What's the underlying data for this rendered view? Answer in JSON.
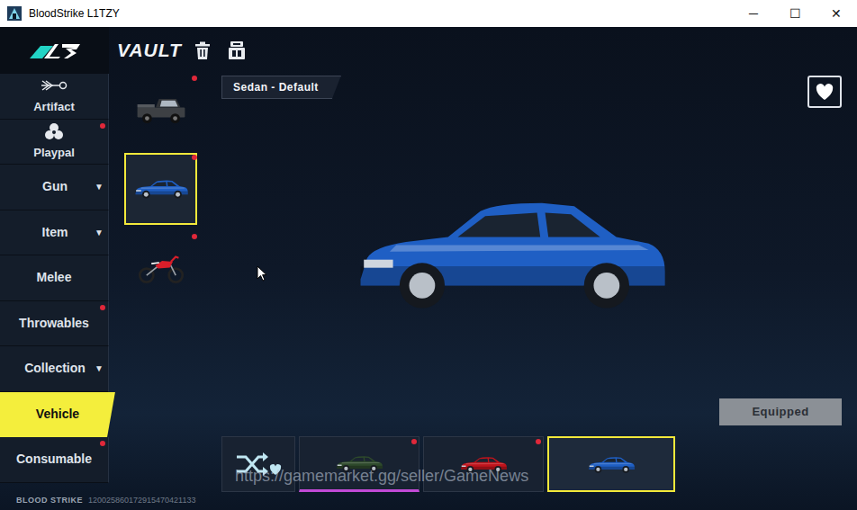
{
  "window": {
    "title": "BloodStrike L1TZY",
    "controls": [
      "─",
      "☐",
      "✕"
    ]
  },
  "header": {
    "title": "VAULT"
  },
  "sidebar": {
    "items": [
      {
        "label": "Artifact",
        "kind": "artifact",
        "selected": false,
        "new": false
      },
      {
        "label": "Playpal",
        "kind": "playpal",
        "selected": false,
        "new": true
      },
      {
        "label": "Gun",
        "kind": "text",
        "arrow": "▼",
        "selected": false,
        "new": false
      },
      {
        "label": "Item",
        "kind": "text",
        "arrow": "▼",
        "selected": false,
        "new": false
      },
      {
        "label": "Melee",
        "kind": "text",
        "selected": false,
        "new": false
      },
      {
        "label": "Throwables",
        "kind": "text",
        "selected": false,
        "new": true
      },
      {
        "label": "Collection",
        "kind": "text",
        "arrow": "▼",
        "selected": false,
        "new": false
      },
      {
        "label": "Vehicle",
        "kind": "text",
        "selected": true,
        "new": false
      },
      {
        "label": "Consumable",
        "kind": "text",
        "selected": false,
        "new": true
      }
    ]
  },
  "vehicles": [
    {
      "kind": "truck",
      "selected": false,
      "new": true
    },
    {
      "kind": "sedan",
      "selected": true,
      "new": true
    },
    {
      "kind": "motorbike",
      "selected": false,
      "new": true
    }
  ],
  "preview": {
    "name": "Sedan - Default",
    "button": "Equipped"
  },
  "skins": [
    {
      "kind": "random",
      "selected": false,
      "new": false,
      "rare": false
    },
    {
      "kind": "car",
      "color": "#2e4a2c",
      "selected": false,
      "new": true,
      "rare": true
    },
    {
      "kind": "car",
      "color": "#c0141c",
      "selected": false,
      "new": true,
      "rare": false
    },
    {
      "kind": "car",
      "color": "#1f5fc4",
      "selected": true,
      "new": false,
      "rare": false
    }
  ],
  "watermark": "https://gamemarket.gg/seller/GameNews",
  "footer": {
    "brand": "BLOOD STRIKE",
    "id": "120025860172915470421133"
  }
}
